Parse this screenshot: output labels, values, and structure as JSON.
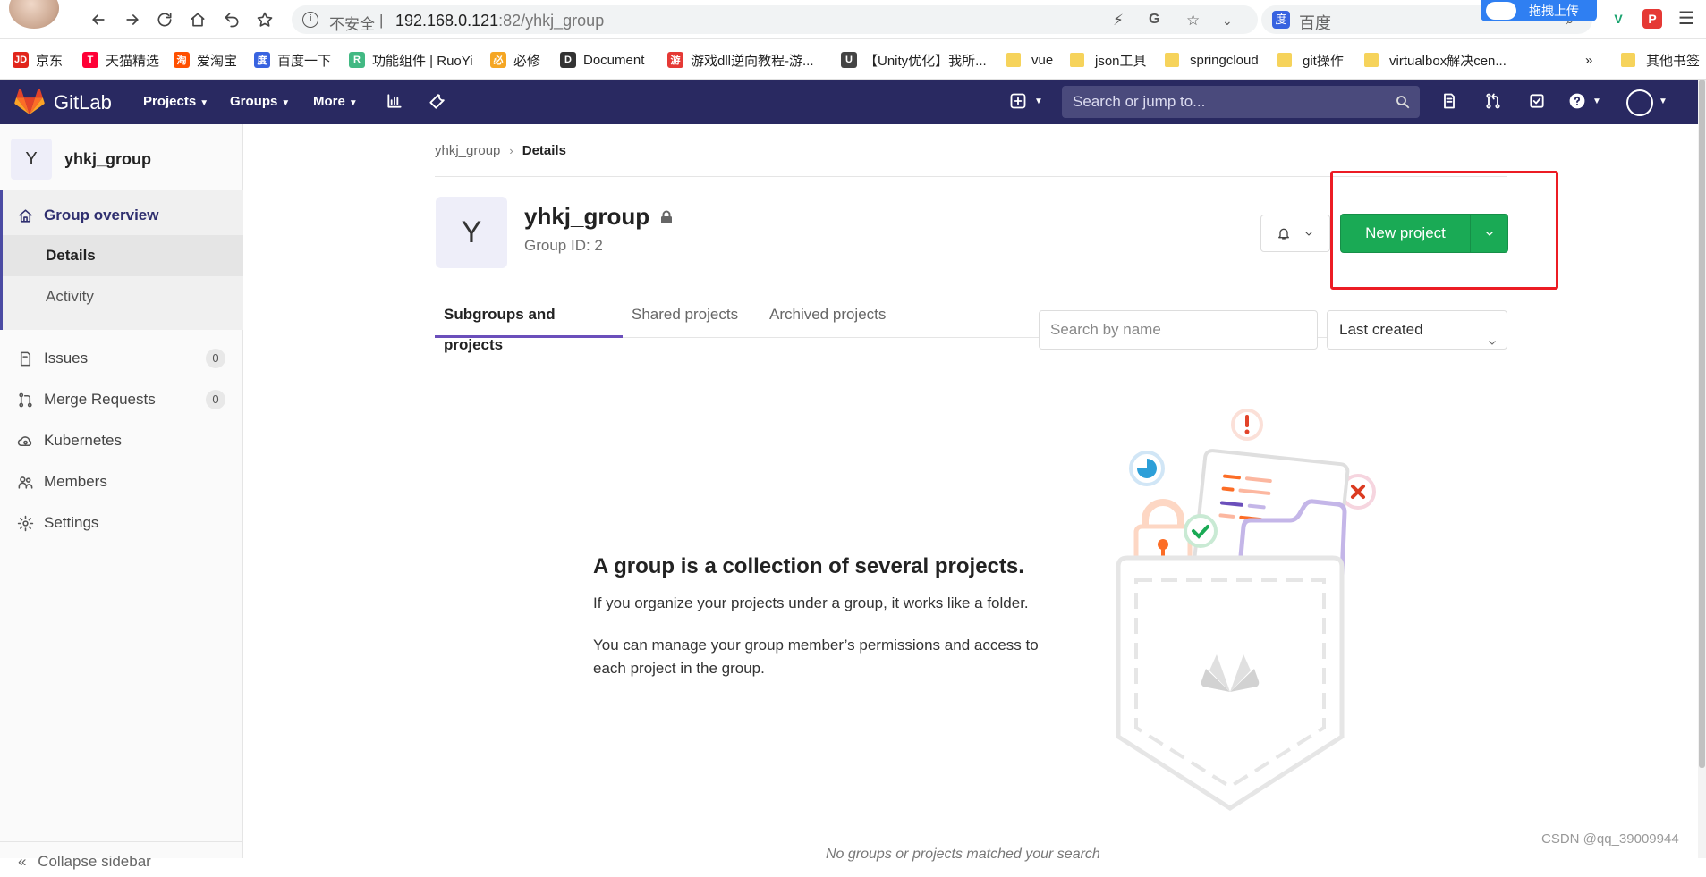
{
  "browser": {
    "insecure_label": "不安全",
    "url_host": "192.168.0.121",
    "url_path": ":82/yhkj_group",
    "search_engine_label": "百度",
    "upload_badge": "拖拽上传",
    "more_bookmarks": "»",
    "other_bookmarks": "其他书签",
    "bookmarks": [
      {
        "label": "京东",
        "icon": "JD",
        "color": "#e1251b"
      },
      {
        "label": "天猫精选",
        "icon": "T",
        "color": "#ff0036"
      },
      {
        "label": "爱淘宝",
        "icon": "淘",
        "color": "#ff5000"
      },
      {
        "label": "百度一下",
        "icon": "度",
        "color": "#3863e0"
      },
      {
        "label": "功能组件 | RuoYi",
        "icon": "R",
        "color": "#42b983"
      },
      {
        "label": "必修",
        "icon": "必",
        "color": "#f5a623"
      },
      {
        "label": "Document",
        "icon": "D",
        "color": "#333333"
      },
      {
        "label": "游戏dll逆向教程-游...",
        "icon": "游",
        "color": "#e53935"
      },
      {
        "label": "【Unity优化】我所...",
        "icon": "U",
        "color": "#444444"
      },
      {
        "label": "vue",
        "icon": "folder"
      },
      {
        "label": "json工具",
        "icon": "folder"
      },
      {
        "label": "springcloud",
        "icon": "folder"
      },
      {
        "label": "git操作",
        "icon": "folder"
      },
      {
        "label": "virtualbox解决cen...",
        "icon": "folder"
      }
    ]
  },
  "header": {
    "brand": "GitLab",
    "menus": [
      "Projects",
      "Groups",
      "More"
    ],
    "search_placeholder": "Search or jump to...",
    "icons": [
      "plus-icon",
      "chart-icon",
      "wrench-icon",
      "todo-icon",
      "merge-request-icon",
      "issues-icon",
      "help-icon",
      "user-avatar"
    ]
  },
  "sidebar": {
    "group_initial": "Y",
    "group_name": "yhkj_group",
    "overview_label": "Group overview",
    "details_label": "Details",
    "activity_label": "Activity",
    "issues_label": "Issues",
    "issues_count": "0",
    "merge_label": "Merge Requests",
    "merge_count": "0",
    "kubernetes_label": "Kubernetes",
    "members_label": "Members",
    "settings_label": "Settings",
    "collapse_label": "Collapse sidebar"
  },
  "main": {
    "breadcrumb_root": "yhkj_group",
    "breadcrumb_sep": "›",
    "breadcrumb_current": "Details",
    "group_initial": "Y",
    "group_title": "yhkj_group",
    "group_id": "Group ID: 2",
    "new_project_label": "New project",
    "tabs": [
      "Subgroups and projects",
      "Shared projects",
      "Archived projects"
    ],
    "search_placeholder": "Search by name",
    "sort_value": "Last created",
    "empty_title": "A group is a collection of several projects.",
    "empty_p1": "If you organize your projects under a group, it works like a folder.",
    "empty_p2": "You can manage your group member’s permissions and access to each project in the group.",
    "no_match": "No groups or projects matched your search"
  },
  "watermark": "CSDN @qq_39009944",
  "colors": {
    "header_bg": "#292961",
    "primary_green": "#1aaa55",
    "highlight_red": "#ec1c24",
    "tab_active": "#6b4fbb"
  }
}
